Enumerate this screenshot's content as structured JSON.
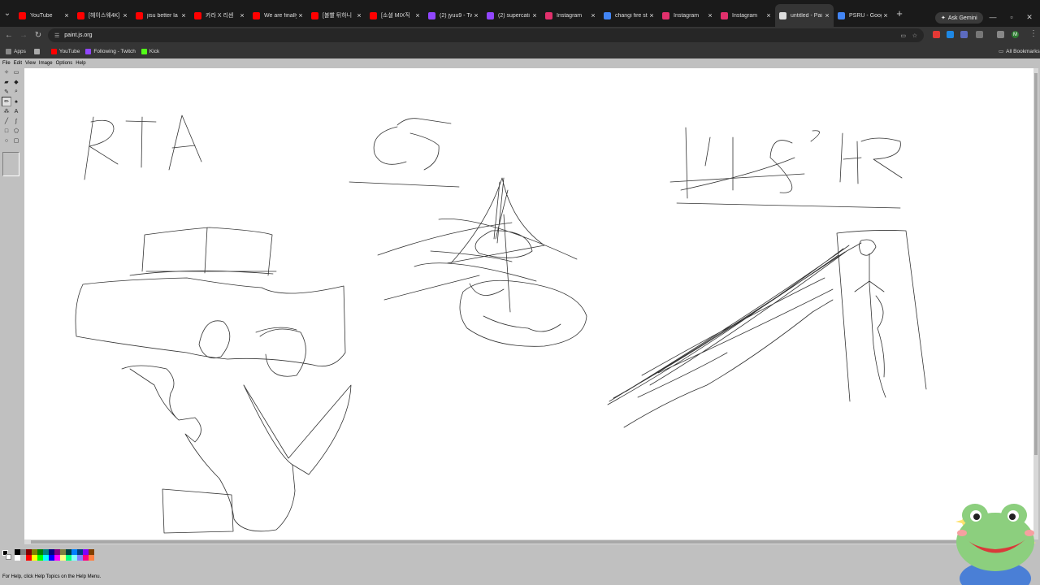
{
  "browser": {
    "tabs": [
      {
        "title": "YouTube",
        "color": "#ff0000"
      },
      {
        "title": "[헤이스웨4K]",
        "color": "#ff0000"
      },
      {
        "title": "jisu better la",
        "color": "#ff0000"
      },
      {
        "title": "카라 X 리센",
        "color": "#ff0000"
      },
      {
        "title": "We are finally",
        "color": "#ff0000"
      },
      {
        "title": "[볼빨 뒤하니",
        "color": "#ff0000"
      },
      {
        "title": "[소셜 MIX직",
        "color": "#ff0000"
      },
      {
        "title": "(2) jyuu9 - Tw",
        "color": "#9146ff"
      },
      {
        "title": "(2) supercati",
        "color": "#9146ff"
      },
      {
        "title": "Instagram",
        "color": "#e1306c"
      },
      {
        "title": "changi fire st",
        "color": "#4285f4"
      },
      {
        "title": "Instagram",
        "color": "#e1306c"
      },
      {
        "title": "Instagram",
        "color": "#e1306c"
      },
      {
        "title": "untitled - Pai",
        "color": "#dddddd",
        "active": true
      },
      {
        "title": "PSRU - Goog",
        "color": "#4285f4"
      }
    ],
    "ask_gemini": "Ask Gemini",
    "url": "paint.js.org",
    "profile_initial": "M",
    "bookmarks": [
      {
        "label": "Apps",
        "color": "#888888"
      },
      {
        "label": "YouTube",
        "color": "#ff0000"
      },
      {
        "label": "Following - Twitch",
        "color": "#9146ff"
      },
      {
        "label": "Kick",
        "color": "#53fc18"
      }
    ],
    "all_bookmarks": "All Bookmarks"
  },
  "paint": {
    "menu": [
      "File",
      "Edit",
      "View",
      "Image",
      "Options",
      "Help"
    ],
    "tools": [
      "free-select-icon",
      "select-icon",
      "eraser-icon",
      "fill-icon",
      "color-picker-icon",
      "magnifier-icon",
      "pencil-icon",
      "brush-icon",
      "airbrush-icon",
      "text-icon",
      "line-icon",
      "curve-icon",
      "rectangle-icon",
      "polygon-icon",
      "ellipse-icon",
      "rounded-rect-icon"
    ],
    "palette": [
      "#000000",
      "#808080",
      "#800000",
      "#808000",
      "#008000",
      "#008080",
      "#000080",
      "#800080",
      "#808040",
      "#004040",
      "#0080ff",
      "#004080",
      "#8000ff",
      "#804000",
      "#ffffff",
      "#c0c0c0",
      "#ff0000",
      "#ffff00",
      "#00ff00",
      "#00ffff",
      "#0000ff",
      "#ff00ff",
      "#ffff80",
      "#00ff80",
      "#80ffff",
      "#8080ff",
      "#ff0080",
      "#ff8040"
    ],
    "status": "For Help, click Help Topics on the Help Menu."
  }
}
